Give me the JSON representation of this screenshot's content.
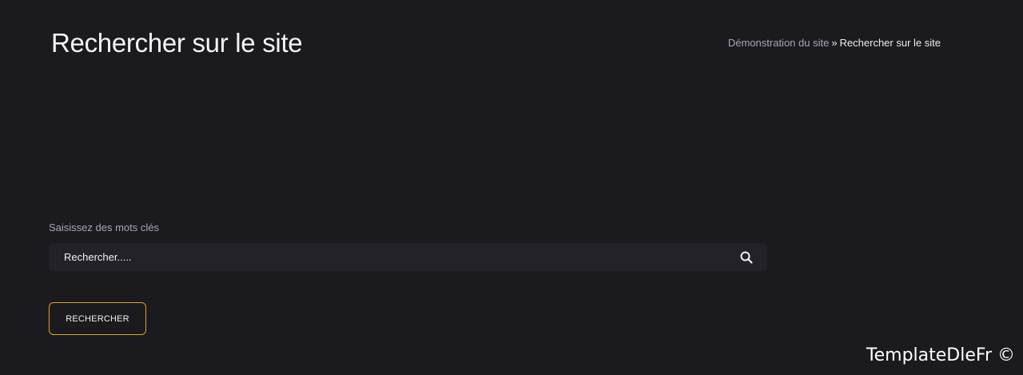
{
  "header": {
    "title": "Rechercher sur le site"
  },
  "breadcrumb": {
    "home": "Démonstration du site",
    "separator": "»",
    "current": "Rechercher sur le site"
  },
  "search": {
    "label": "Saisissez des mots clés",
    "placeholder": "Rechercher.....",
    "value": "",
    "icon": "search-icon",
    "submit_label": "RECHERCHER"
  },
  "footer": {
    "watermark": "TemplateDleFr ©"
  },
  "colors": {
    "background": "#1b1a1f",
    "input_background": "#232228",
    "accent": "#e0a21c",
    "muted_text": "#a9a8ae",
    "text": "#f4f4f6"
  }
}
